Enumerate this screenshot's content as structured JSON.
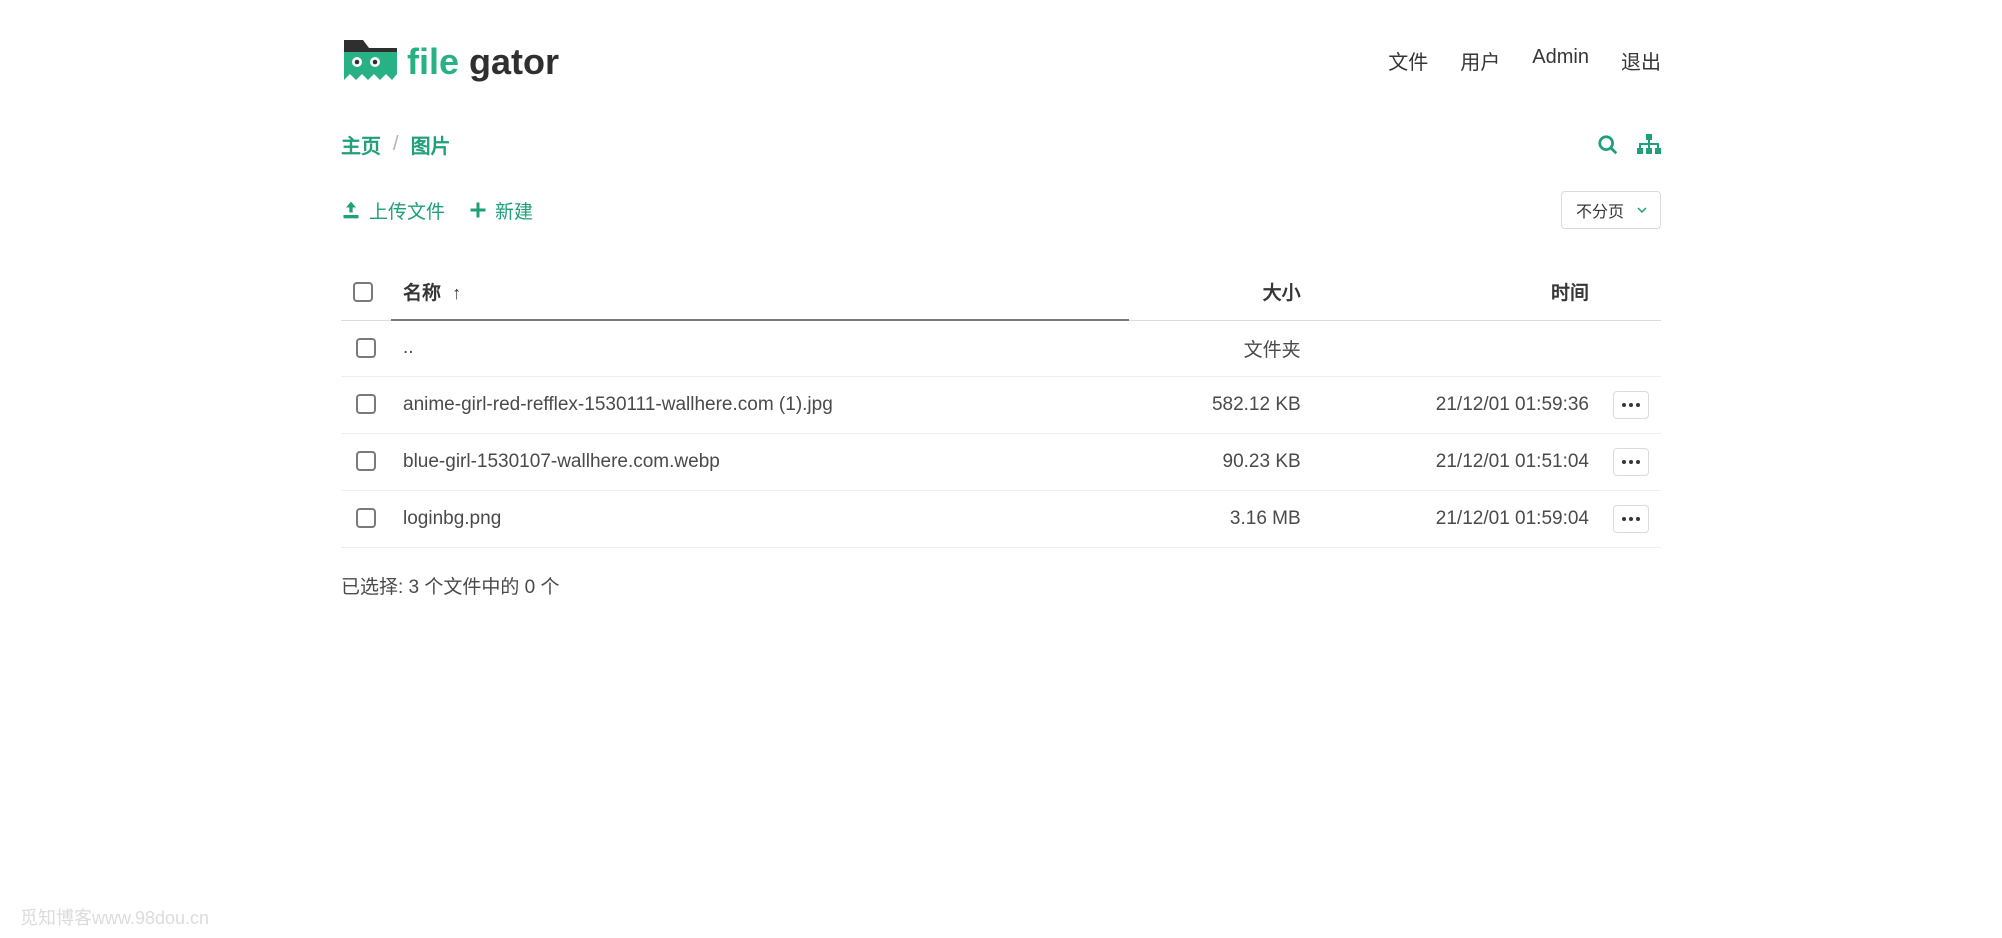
{
  "brand": "filegator",
  "nav": {
    "files": "文件",
    "users": "用户",
    "admin": "Admin",
    "logout": "退出"
  },
  "breadcrumb": {
    "home": "主页",
    "current": "图片"
  },
  "toolbar": {
    "upload": "上传文件",
    "new": "新建",
    "pagination": "不分页"
  },
  "table": {
    "headers": {
      "name": "名称",
      "size": "大小",
      "time": "时间"
    },
    "parent": {
      "name": "..",
      "size": "文件夹"
    },
    "rows": [
      {
        "name": "anime-girl-red-refflex-1530111-wallhere.com (1).jpg",
        "size": "582.12 KB",
        "time": "21/12/01 01:59:36"
      },
      {
        "name": "blue-girl-1530107-wallhere.com.webp",
        "size": "90.23 KB",
        "time": "21/12/01 01:51:04"
      },
      {
        "name": "loginbg.png",
        "size": "3.16 MB",
        "time": "21/12/01 01:59:04"
      }
    ]
  },
  "selection": "已选择: 3 个文件中的 0 个",
  "watermark": "觅知博客www.98dou.cn"
}
